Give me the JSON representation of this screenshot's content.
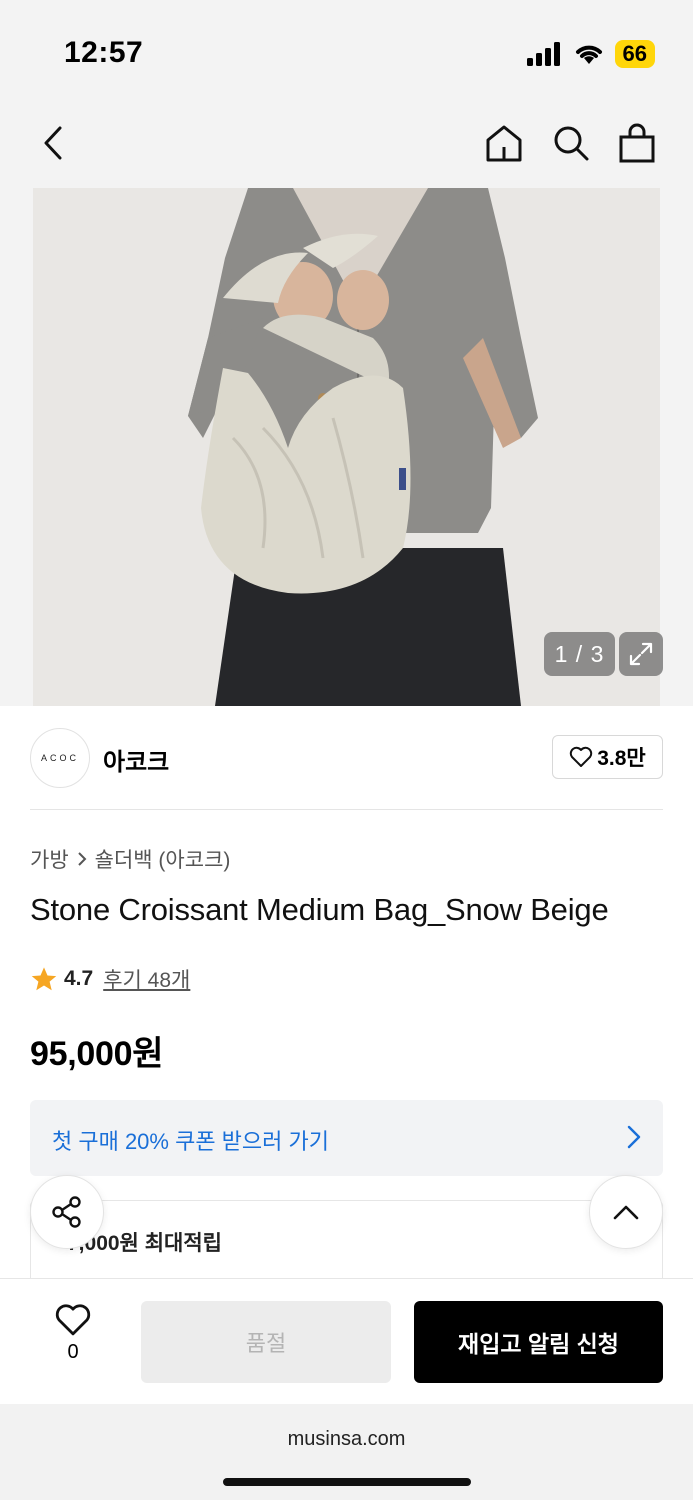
{
  "status_bar": {
    "time": "12:57",
    "battery": "66"
  },
  "gallery": {
    "counter": "1 / 3"
  },
  "brand": {
    "logo_text": "ACOC",
    "name": "아코크",
    "likes": "3.8만"
  },
  "breadcrumb": {
    "category": "가방",
    "subcategory": "숄더백 (아코크)"
  },
  "product": {
    "title": "Stone Croissant Medium Bag_Snow Beige",
    "rating": "4.7",
    "reviews": "후기 48개",
    "price": "95,000원"
  },
  "coupon": {
    "text": "첫 구매 20% 쿠폰 받으러 가기"
  },
  "points": {
    "text": "7,000원 최대적립"
  },
  "bottom": {
    "wish_count": "0",
    "soldout_label": "품절",
    "restock_label": "재입고 알림 신청"
  },
  "browser": {
    "url": "musinsa.com"
  },
  "colors": {
    "accent_blue": "#1a6fd8",
    "star": "#f6a623",
    "battery": "#ffd60a"
  }
}
